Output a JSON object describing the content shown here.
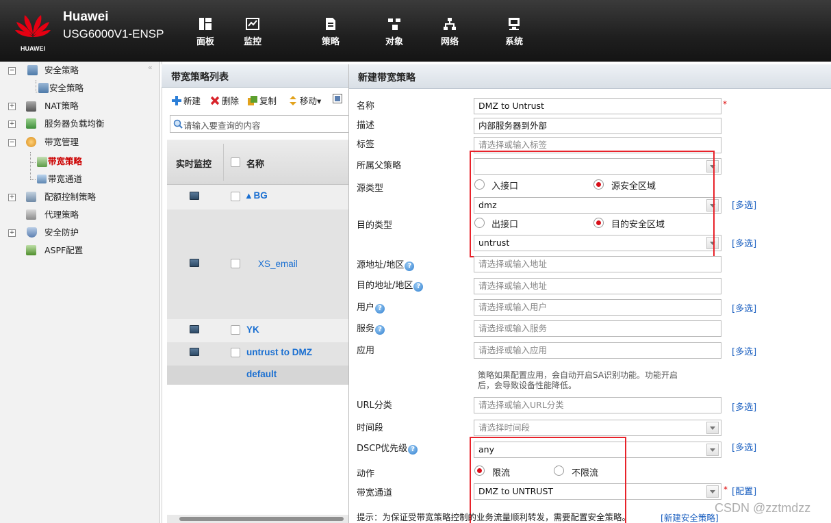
{
  "header": {
    "brand": "Huawei",
    "model": "USG6000V1-ENSP",
    "logo_text": "HUAWEI",
    "nav": [
      {
        "label": "面板",
        "icon": "dashboard-icon"
      },
      {
        "label": "监控",
        "icon": "monitor-icon"
      },
      {
        "label": "策略",
        "icon": "policy-icon"
      },
      {
        "label": "对象",
        "icon": "object-icon"
      },
      {
        "label": "网络",
        "icon": "network-icon"
      },
      {
        "label": "系统",
        "icon": "system-icon"
      }
    ]
  },
  "sidebar": {
    "collapse_glyph": "«",
    "items": [
      {
        "label": "安全策略",
        "expander": "−"
      },
      {
        "label": "安全策略"
      },
      {
        "label": "NAT策略",
        "expander": "+"
      },
      {
        "label": "服务器负载均衡",
        "expander": "+"
      },
      {
        "label": "带宽管理",
        "expander": "−"
      },
      {
        "label": "带宽策略",
        "active": true
      },
      {
        "label": "带宽通道"
      },
      {
        "label": "配额控制策略",
        "expander": "+"
      },
      {
        "label": "代理策略"
      },
      {
        "label": "安全防护",
        "expander": "+"
      },
      {
        "label": "ASPF配置"
      }
    ]
  },
  "list": {
    "title": "带宽策略列表",
    "toolbar": {
      "new": "新建",
      "delete": "删除",
      "copy": "复制",
      "move": "移动▾"
    },
    "search_placeholder": "请输入要查询的内容",
    "columns": {
      "monitor": "实时监控",
      "name": "名称"
    },
    "rows": [
      {
        "name": "▴ BG"
      },
      {
        "name": "XS_email"
      },
      {
        "name": "YK"
      },
      {
        "name": "untrust to DMZ"
      }
    ],
    "default_row": "default"
  },
  "dialog": {
    "title": "新建带宽策略",
    "labels": {
      "name": "名称",
      "desc": "描述",
      "tag": "标签",
      "parent": "所属父策略",
      "src_type": "源类型",
      "dst_type": "目的类型",
      "src_addr": "源地址/地区",
      "dst_addr": "目的地址/地区",
      "user": "用户",
      "service": "服务",
      "app": "应用",
      "url": "URL分类",
      "time": "时间段",
      "dscp": "DSCP优先级",
      "action": "动作",
      "channel": "带宽通道"
    },
    "values": {
      "name": "DMZ to Untrust",
      "desc": "内部服务器到外部",
      "src_zone": "dmz",
      "dst_zone": "untrust",
      "dscp": "any",
      "channel": "DMZ  to UNTRUST"
    },
    "placeholders": {
      "tag": "请选择或输入标签",
      "src_addr": "请选择或输入地址",
      "dst_addr": "请选择或输入地址",
      "user": "请选择或输入用户",
      "service": "请选择或输入服务",
      "app": "请选择或输入应用",
      "url": "请选择或输入URL分类",
      "time": "请选择时间段"
    },
    "radios": {
      "in_iface": "入接口",
      "src_zone": "源安全区域",
      "out_iface": "出接口",
      "dst_zone": "目的安全区域",
      "limit": "限流",
      "no_limit": "不限流"
    },
    "app_hint_1": "策略如果配置应用，会自动开启SA识别功能。功能开启",
    "app_hint_2": "后，会导致设备性能降低。",
    "multi_select": "[多选]",
    "config_link": "[配置]",
    "required_mark": "*",
    "help_glyph": "?",
    "bottom_tip": "提示：为保证受带宽策略控制的业务流量顺利转发，需要配置安全策略。",
    "new_security_link": "[新建安全策略]"
  },
  "watermark": "CSDN @zztmdzz",
  "colors": {
    "accent_red": "#e8222a",
    "link_blue": "#1a5fc0",
    "active_red": "#cc0000"
  }
}
